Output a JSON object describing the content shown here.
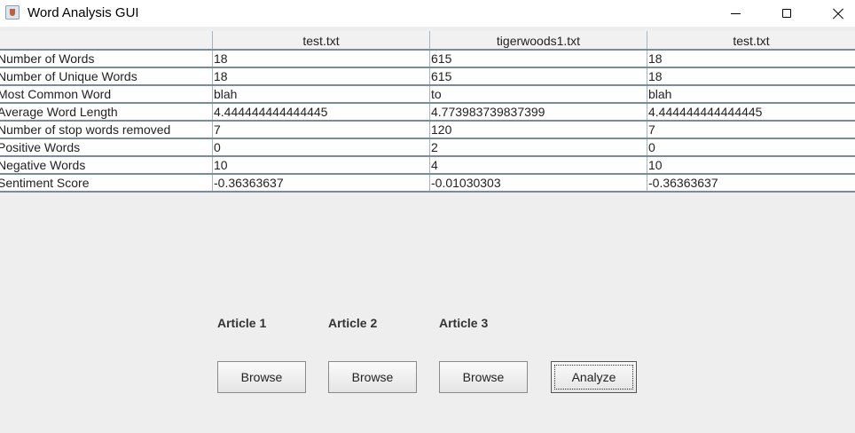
{
  "window": {
    "title": "Word Analysis GUI",
    "icon": "java-cup-icon"
  },
  "table": {
    "headers": [
      "",
      "test.txt",
      "tigerwoods1.txt",
      "test.txt"
    ],
    "rows": [
      [
        "Number of Words",
        "18",
        "615",
        "18"
      ],
      [
        "Number of Unique Words",
        "18",
        "615",
        "18"
      ],
      [
        "Most Common Word",
        "blah",
        "to",
        "blah"
      ],
      [
        "Average Word Length",
        "4.444444444444445",
        "4.773983739837399",
        "4.444444444444445"
      ],
      [
        "Number of stop words removed",
        "7",
        "120",
        "7"
      ],
      [
        "Positive Words",
        "0",
        "2",
        "0"
      ],
      [
        "Negative Words",
        "10",
        "4",
        "10"
      ],
      [
        "Sentiment Score",
        "-0.36363637",
        "-0.01030303",
        "-0.36363637"
      ]
    ]
  },
  "articles": {
    "labels": [
      "Article 1",
      "Article 2",
      "Article 3"
    ]
  },
  "buttons": {
    "browse": "Browse",
    "analyze": "Analyze"
  }
}
